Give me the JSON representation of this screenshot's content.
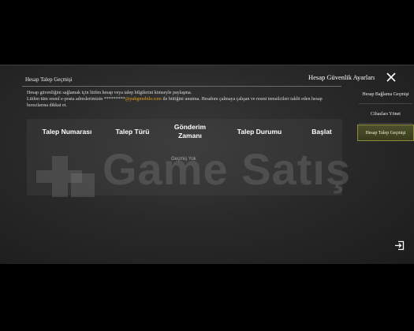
{
  "panel": {
    "history_title": "Hesap Talep Geçmişi",
    "warning_line1": "Hesap güvenliğini sağlamak için lütfen hesap veya talep bilgilerini kimseyle paylaşma.",
    "warning_line2_prefix": "Lütfen tüm resmî e-posta adreslerimizin *********",
    "warning_email": "@pubgmobile.com",
    "warning_line2_suffix": " ile bittiğini unutma. Hesabını çalmaya çalışan ve resmi temsilcileri taklit eden hesap",
    "warning_line3": "hırsızlarına dikkat et."
  },
  "table": {
    "columns": [
      "Talep Numarası",
      "Talep Türü",
      "Gönderim\nZamanı",
      "Talep Durumu",
      "Başlat"
    ],
    "empty_text": "Geçmiş Yok"
  },
  "watermark": {
    "text": "Game Satış"
  },
  "security": {
    "title": "Hesap Güvenlik Ayarları",
    "menu": [
      {
        "label": "Hesap Bağlama Geçmişi",
        "active": false
      },
      {
        "label": "Cihazları Yönet",
        "active": false
      },
      {
        "label": "Hesap Talep Geçmişi",
        "active": true
      }
    ]
  },
  "colors": {
    "accent_email": "#e6a21a",
    "active_tab": "#3a3d1d",
    "active_border": "#8a8d42"
  },
  "icons": {
    "close": "close-icon",
    "exit": "exit-icon"
  }
}
